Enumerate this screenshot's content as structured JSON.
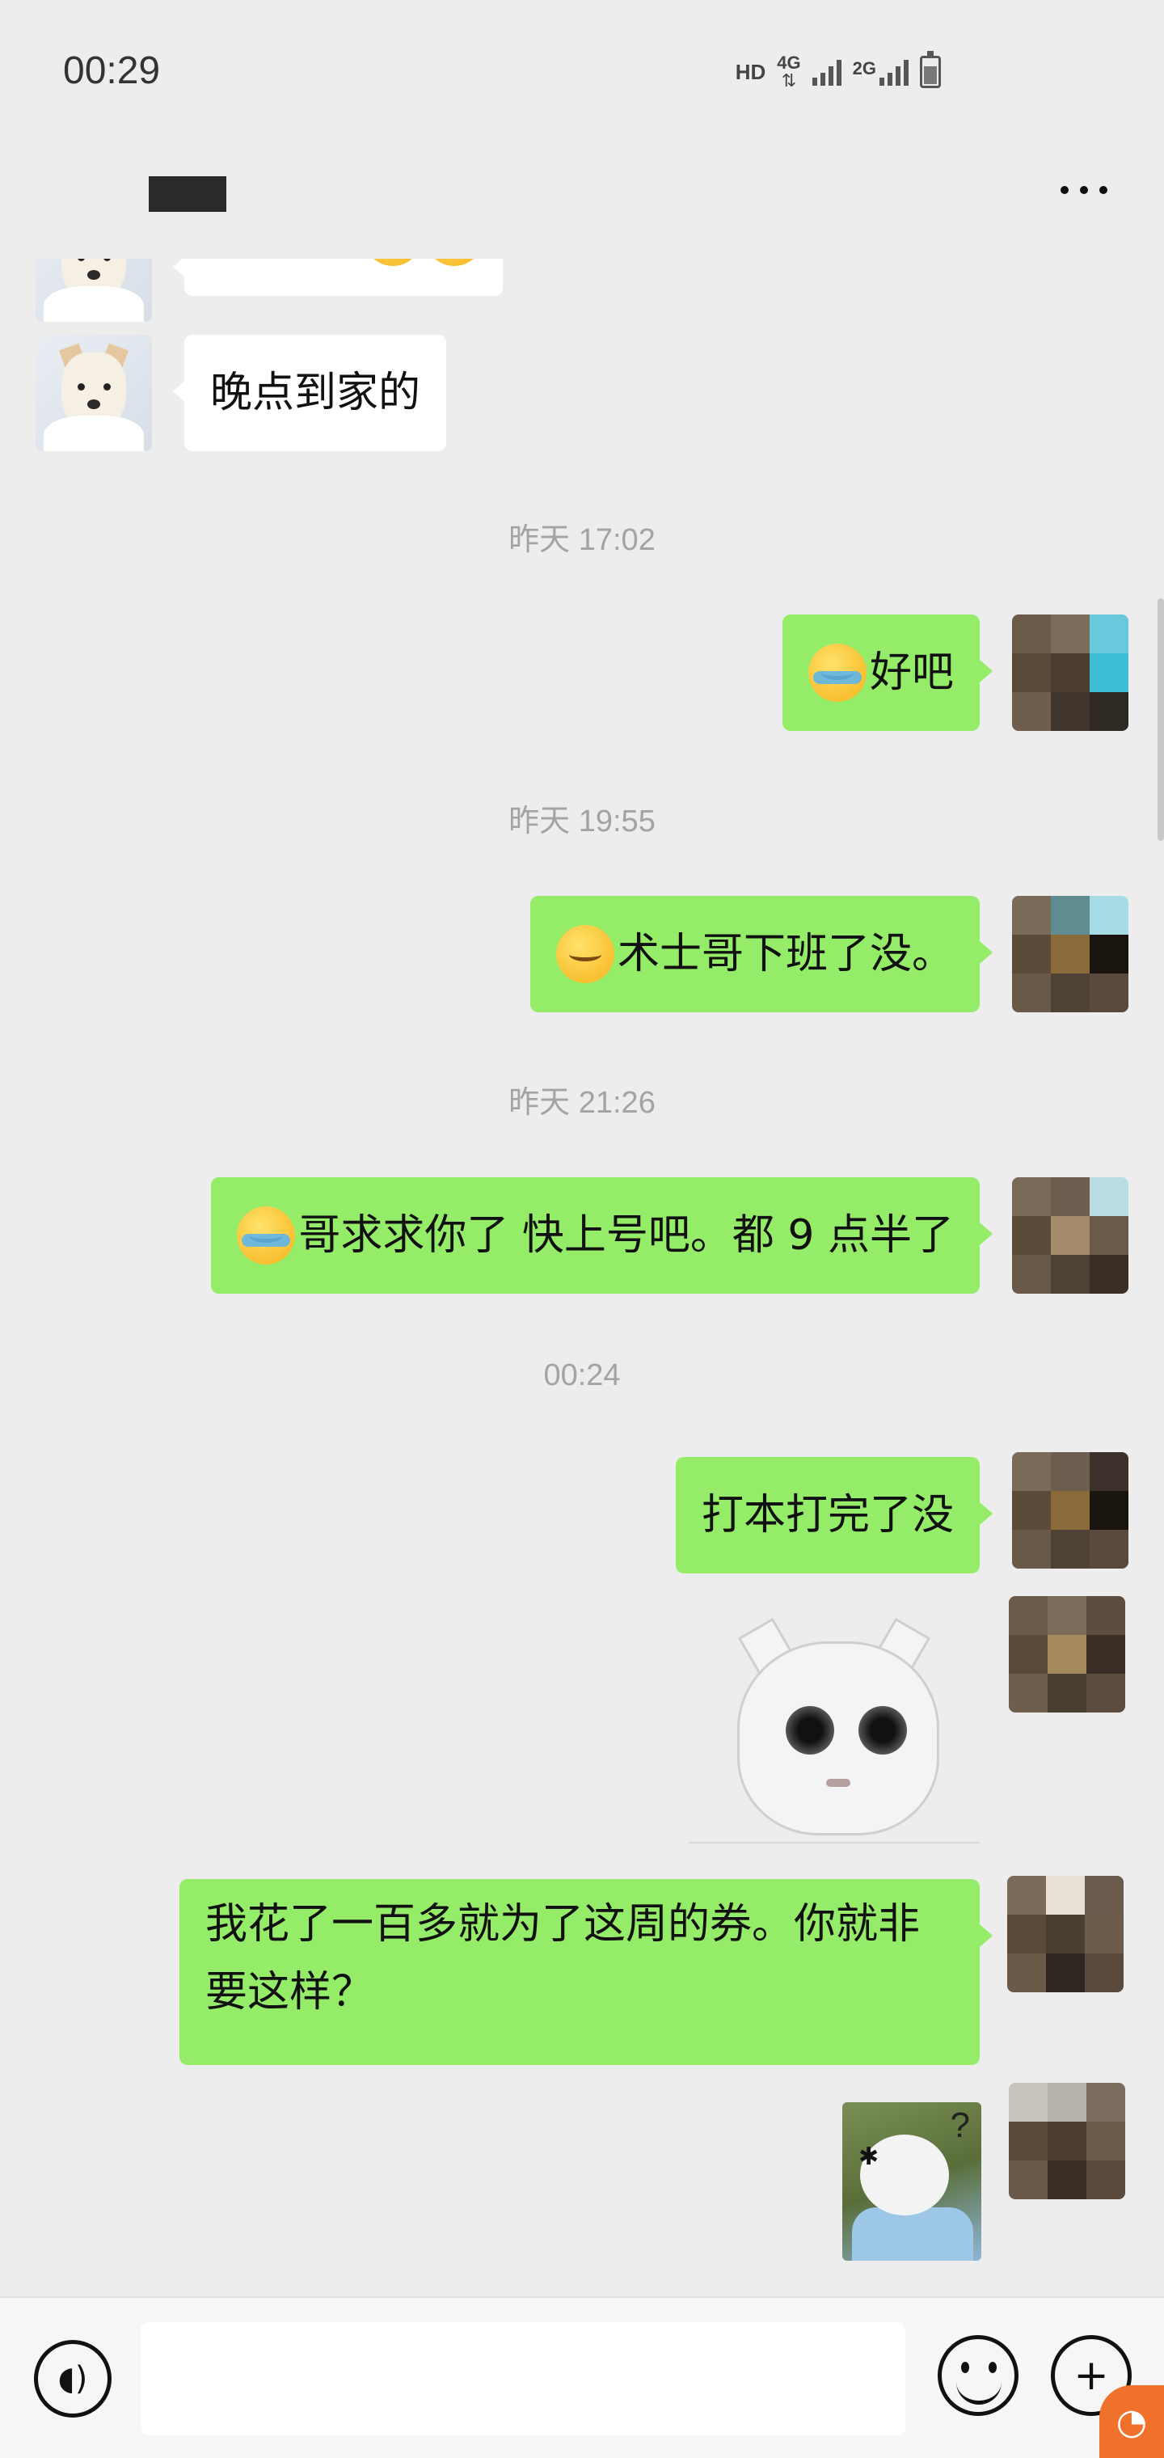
{
  "status_bar": {
    "time": "00:29",
    "hd": "HD",
    "net1": "4G",
    "net2": "2G"
  },
  "header": {
    "contact_name": "███"
  },
  "messages": [
    {
      "dir": "in",
      "text": "晚点到家的"
    },
    {
      "timestamp": "昨天 17:02"
    },
    {
      "dir": "out",
      "emoji": "crying-face",
      "text": "好吧"
    },
    {
      "timestamp": "昨天 19:55"
    },
    {
      "dir": "out",
      "emoji": "relieved-face",
      "text": "术士哥下班了没。"
    },
    {
      "timestamp": "昨天 21:26"
    },
    {
      "dir": "out",
      "emoji": "crying-face",
      "text": "哥求求你了 快上号吧。都 9 点半了"
    },
    {
      "timestamp": "00:24"
    },
    {
      "dir": "out",
      "text": "打本打完了没"
    },
    {
      "dir": "out",
      "sticker": "panda-sticker"
    },
    {
      "dir": "out",
      "text": "我花了一百多就为了这周的券。你就非要这样？"
    },
    {
      "dir": "out",
      "sticker": "meme-sticker",
      "sticker_text": "?"
    }
  ],
  "input": {
    "placeholder": ""
  },
  "colors": {
    "background": "#ededed",
    "outgoing_bubble": "#95ec69",
    "incoming_bubble": "#ffffff",
    "timestamp": "#a3a3a3"
  }
}
